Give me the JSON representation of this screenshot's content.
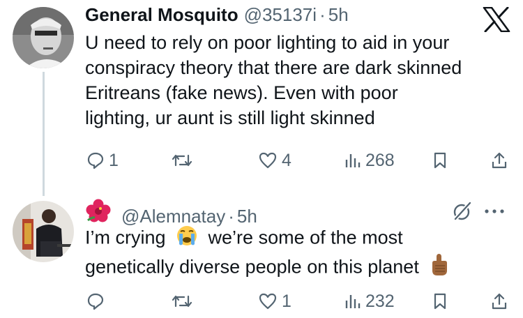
{
  "tweet1": {
    "author_name": "General Mosquito",
    "handle": "@35137i",
    "separator": "·",
    "time": "5h",
    "lines": [
      "U need to rely on poor lighting to aid in your",
      "conspiracy theory that there are dark skinned",
      "Eritreans (fake news). Even with poor",
      "lighting, ur aunt is still light skinned"
    ],
    "actions": {
      "replies": "1",
      "retweets": "",
      "likes": "4",
      "views": "268"
    }
  },
  "tweet2": {
    "handle": "@Alemnatay",
    "separator": "·",
    "time": "5h",
    "line1_a": "I’m crying",
    "line1_b": "we’re some of the most",
    "line2": "genetically diverse people on this planet",
    "actions": {
      "replies": "",
      "retweets": "",
      "likes": "1",
      "views": "232"
    }
  },
  "icons": {
    "platform": "x-logo-icon",
    "reply": "comment-bubble-icon",
    "retweet": "retweet-arrows-icon",
    "like": "heart-icon",
    "views": "bar-chart-icon",
    "bookmark": "bookmark-icon",
    "share": "share-upload-icon",
    "grok": "grok-slash-circle-icon",
    "more": "more-dots-icon",
    "name_emoji": "hibiscus-flower-emoji",
    "crying_emoji": "loudly-crying-face-emoji",
    "pointing_emoji": "pointing-up-hand-emoji"
  },
  "colors": {
    "text": "#0f1419",
    "secondary": "#536471",
    "thread_line": "#cfd9de",
    "background": "#ffffff"
  }
}
